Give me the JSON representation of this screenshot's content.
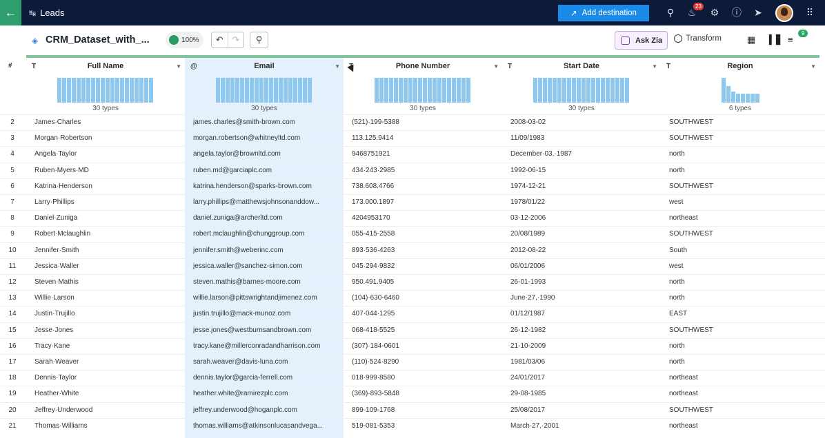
{
  "topbar": {
    "back_icon": "arrow-left-icon",
    "title": "Leads",
    "add_destination": "Add destination",
    "notifications_count": "23"
  },
  "toolbar": {
    "dataset_name": "CRM_Dataset_with_...",
    "quality": "100%",
    "ask_zia": "Ask Zia",
    "transform": "Transform",
    "badge": "9"
  },
  "grid": {
    "index_header": "#",
    "columns": [
      {
        "type": "T",
        "name": "Full Name",
        "types_label": "30 types"
      },
      {
        "type": "@",
        "name": "Email",
        "types_label": "30 types"
      },
      {
        "type": "T",
        "name": "Phone Number",
        "types_label": "30 types"
      },
      {
        "type": "T",
        "name": "Start Date",
        "types_label": "30 types"
      },
      {
        "type": "T",
        "name": "Region",
        "types_label": "6 types"
      }
    ],
    "rows": [
      {
        "n": "2",
        "name": "James·Charles",
        "email": "james.charles@smith-brown.com",
        "phone": "(521)·199-5388",
        "date": "2008-03-02",
        "region": "SOUTHWEST"
      },
      {
        "n": "3",
        "name": "Morgan·Robertson",
        "email": "morgan.robertson@whitneyltd.com",
        "phone": "113.125.9414",
        "date": "11/09/1983",
        "region": "SOUTHWEST"
      },
      {
        "n": "4",
        "name": "Angela·Taylor",
        "email": "angela.taylor@brownltd.com",
        "phone": "9468751921",
        "date": "December·03,·1987",
        "region": "north"
      },
      {
        "n": "5",
        "name": "Ruben·Myers·MD",
        "email": "ruben.md@garciaplc.com",
        "phone": "434·243·2985",
        "date": "1992-06-15",
        "region": "north"
      },
      {
        "n": "6",
        "name": "Katrina·Henderson",
        "email": "katrina.henderson@sparks-brown.com",
        "phone": "738.608.4766",
        "date": "1974-12-21",
        "region": "SOUTHWEST"
      },
      {
        "n": "7",
        "name": "Larry·Phillips",
        "email": "larry.phillips@matthewsjohnsonanddow...",
        "phone": "173.000.1897",
        "date": "1978/01/22",
        "region": "west"
      },
      {
        "n": "8",
        "name": "Daniel·Zuniga",
        "email": "daniel.zuniga@archerltd.com",
        "phone": "4204953170",
        "date": "03-12-2006",
        "region": "northeast"
      },
      {
        "n": "9",
        "name": "Robert·Mclaughlin",
        "email": "robert.mclaughlin@chunggroup.com",
        "phone": "055-415-2558",
        "date": "20/08/1989",
        "region": "SOUTHWEST"
      },
      {
        "n": "10",
        "name": "Jennifer·Smith",
        "email": "jennifer.smith@weberinc.com",
        "phone": "893·536·4263",
        "date": "2012-08-22",
        "region": "South"
      },
      {
        "n": "11",
        "name": "Jessica·Waller",
        "email": "jessica.waller@sanchez-simon.com",
        "phone": "045·294·9832",
        "date": "06/01/2006",
        "region": "west"
      },
      {
        "n": "12",
        "name": "Steven·Mathis",
        "email": "steven.mathis@barnes-moore.com",
        "phone": "950.491.9405",
        "date": "26-01-1993",
        "region": "north"
      },
      {
        "n": "13",
        "name": "Willie·Larson",
        "email": "willie.larson@pittswrightandjimenez.com",
        "phone": "(104)·630-6460",
        "date": "June·27,·1990",
        "region": "north"
      },
      {
        "n": "14",
        "name": "Justin·Trujillo",
        "email": "justin.trujillo@mack-munoz.com",
        "phone": "407·044·1295",
        "date": "01/12/1987",
        "region": "EAST"
      },
      {
        "n": "15",
        "name": "Jesse·Jones",
        "email": "jesse.jones@westburnsandbrown.com",
        "phone": "068-418-5525",
        "date": "26-12-1982",
        "region": "SOUTHWEST"
      },
      {
        "n": "16",
        "name": "Tracy·Kane",
        "email": "tracy.kane@millerconradandharrison.com",
        "phone": "(307)·184-0601",
        "date": "21-10-2009",
        "region": "north"
      },
      {
        "n": "17",
        "name": "Sarah·Weaver",
        "email": "sarah.weaver@davis-luna.com",
        "phone": "(110)·524·8290",
        "date": "1981/03/06",
        "region": "north"
      },
      {
        "n": "18",
        "name": "Dennis·Taylor",
        "email": "dennis.taylor@garcia-ferrell.com",
        "phone": "018·999·8580",
        "date": "24/01/2017",
        "region": "northeast"
      },
      {
        "n": "19",
        "name": "Heather·White",
        "email": "heather.white@ramirezplc.com",
        "phone": "(369)·893-5848",
        "date": "29-08-1985",
        "region": "northeast"
      },
      {
        "n": "20",
        "name": "Jeffrey·Underwood",
        "email": "jeffrey.underwood@hoganplc.com",
        "phone": "899-109-1768",
        "date": "25/08/2017",
        "region": "SOUTHWEST"
      },
      {
        "n": "21",
        "name": "Thomas·Williams",
        "email": "thomas.williams@atkinsonlucasandvega...",
        "phone": "519-081-5353",
        "date": "March·27,·2001",
        "region": "northeast"
      }
    ]
  }
}
